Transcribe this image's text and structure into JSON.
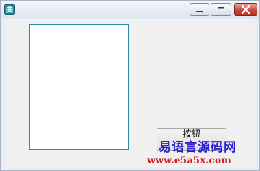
{
  "window": {
    "icon": "app-icon",
    "controls": [
      "minimize-icon",
      "maximize-icon",
      "close-icon"
    ]
  },
  "listbox": {
    "items": []
  },
  "button": {
    "label": "按钮"
  },
  "watermark": {
    "title": "易语言源码网",
    "url": "www.e5a5x.com",
    "colors": {
      "title": "#2a1fd0",
      "url": "#d81b1b"
    }
  }
}
